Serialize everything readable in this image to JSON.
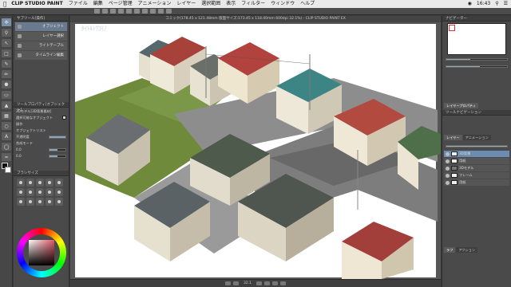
{
  "menubar": {
    "app_name": "CLIP STUDIO PAINT",
    "items": [
      "ファイル",
      "編集",
      "ページ管理",
      "アニメーション",
      "レイヤー",
      "選択範囲",
      "表示",
      "フィルター",
      "ウィンドウ",
      "ヘルプ"
    ],
    "clock": "16:43"
  },
  "document": {
    "title": "コミック(178.45 x 121.48mm 版面サイズ:173.45 x 118.40mm 600dpi 32.1%) - CLIP STUDIO PAINT EX",
    "overlay_label": "ﾀｲﾄﾙﾄｳｺﾓﾉ"
  },
  "subtools": {
    "header": "サブツール[操作]",
    "items": [
      {
        "label": "オブジェクト"
      },
      {
        "label": "レイヤー選択"
      },
      {
        "label": "ライトテーブル"
      },
      {
        "label": "タイムライン編集"
      }
    ]
  },
  "tool_property": {
    "header": "ツールプロパティ[オブジェクト]",
    "object_name": "3Dモデル[3D背景素材]",
    "rows": [
      {
        "label": "選択可能なオブジェクト",
        "kind": "check"
      },
      {
        "label": "操作",
        "kind": "text"
      },
      {
        "label": "オブジェクトリスト",
        "kind": "text"
      },
      {
        "label": "不透明度",
        "kind": "bar",
        "level": 1.0
      },
      {
        "label": "合成モード",
        "kind": "text"
      },
      {
        "label": "0.0",
        "kind": "bar",
        "level": 0.5
      },
      {
        "label": "0.0",
        "kind": "bar",
        "level": 0.5
      }
    ]
  },
  "palette": {
    "header": "ブラシサイズ"
  },
  "right": {
    "navigator_header": "ナビゲーター",
    "tabs": [
      "レイヤープロパティ",
      "レイヤー",
      "アニメーション"
    ],
    "tool_nav_header": "ツールナビゲーション",
    "layers": [
      {
        "name": "3D背景",
        "selected": true,
        "dark": false
      },
      {
        "name": "用紙",
        "selected": false,
        "dark": false
      },
      {
        "name": "3Dモデル",
        "selected": false,
        "dark": true
      },
      {
        "name": "フレーム",
        "selected": false,
        "dark": false
      },
      {
        "name": "用紙",
        "selected": false,
        "dark": false
      }
    ],
    "bottom_tabs": [
      "ラフ",
      "アクション"
    ]
  },
  "navbar": {
    "zoom": "32.1"
  }
}
